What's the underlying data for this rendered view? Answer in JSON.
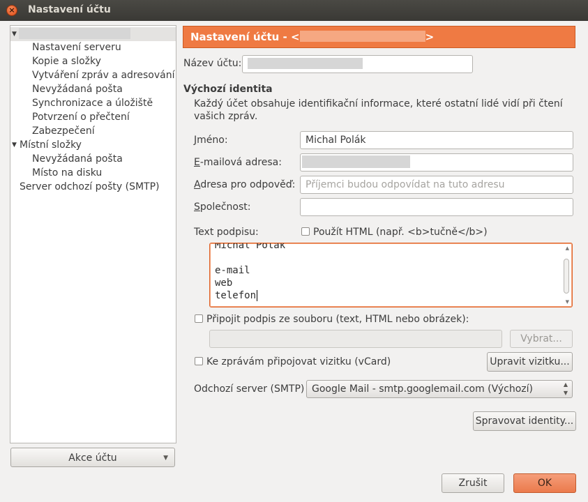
{
  "window": {
    "title": "Nastavení účtu"
  },
  "tree": {
    "groups": [
      {
        "label": "",
        "items": [
          "Nastavení serveru",
          "Kopie a složky",
          "Vytváření zpráv a adresování",
          "Nevyžádaná pošta",
          "Synchronizace a úložiště",
          "Potvrzení o přečtení",
          "Zabezpečení"
        ]
      },
      {
        "label": "Místní složky",
        "items": [
          "Nevyžádaná pošta",
          "Místo na disku"
        ]
      }
    ],
    "smtp_item": "Server odchozí pošty (SMTP)"
  },
  "account_actions": {
    "label": "Akce účtu"
  },
  "header": {
    "prefix": "Nastavení účtu - <",
    "suffix": ">"
  },
  "account_name": {
    "label": "Název účtu:",
    "value": ""
  },
  "identity": {
    "heading": "Výchozí identita",
    "description_line1": "Každý účet obsahuje identifikační informace, které ostatní lidé vidí při čtení",
    "description_line2": "vašich zpráv.",
    "name_label": "Jméno:",
    "name_value": "Michal Polák",
    "email_label": "E-mailová adresa:",
    "email_value": "",
    "reply_label": "Adresa pro odpověď:",
    "reply_placeholder": "Příjemci budou odpovídat na tuto adresu",
    "org_label": "Společnost:",
    "org_value": ""
  },
  "signature": {
    "label": "Text podpisu:",
    "html_checkbox": "Použít HTML (např. <b>tučně</b>)",
    "lines": [
      "Michal Polák",
      "",
      "e-mail",
      "web",
      "telefon"
    ],
    "file_checkbox": "Připojit podpis ze souboru (text, HTML nebo obrázek):",
    "file_value": "",
    "choose_button": "Vybrat..."
  },
  "vcard": {
    "checkbox": "Ke zprávám připojovat vizitku (vCard)",
    "edit_button": "Upravit vizitku..."
  },
  "smtp": {
    "label": "Odchozí server (SMTP)",
    "selected": "Google Mail - smtp.googlemail.com (Výchozí)"
  },
  "manage_identities": "Spravovat identity...",
  "dialog": {
    "cancel": "Zrušit",
    "ok": "OK"
  }
}
